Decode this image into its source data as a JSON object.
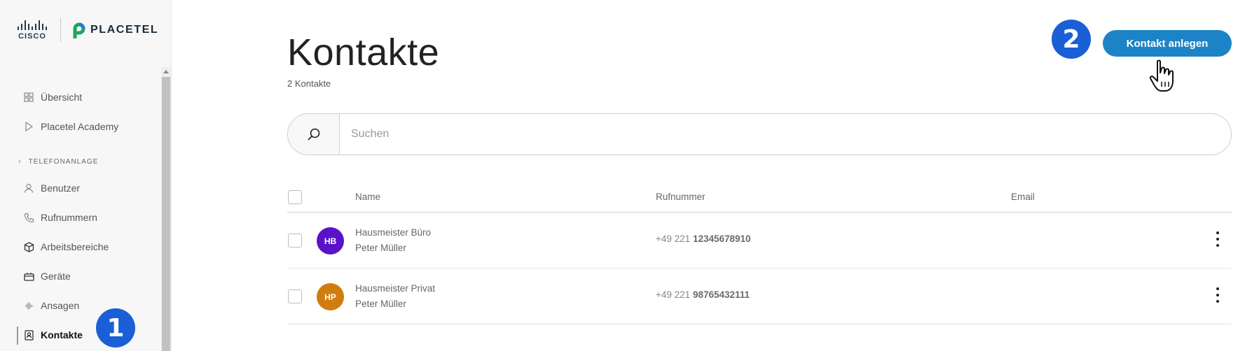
{
  "brand": {
    "cisco": "CISCO",
    "placetel": "PLACETEL"
  },
  "sidebar": {
    "items_top": [
      {
        "label": "Übersicht",
        "icon": "grid-icon"
      },
      {
        "label": "Placetel Academy",
        "icon": "play-icon"
      }
    ],
    "section_label": "TELEFONANLAGE",
    "items": [
      {
        "label": "Benutzer",
        "icon": "user-icon"
      },
      {
        "label": "Rufnummern",
        "icon": "phone-icon"
      },
      {
        "label": "Arbeitsbereiche",
        "icon": "cube-icon"
      },
      {
        "label": "Geräte",
        "icon": "device-icon"
      },
      {
        "label": "Ansagen",
        "icon": "soundwave-icon"
      },
      {
        "label": "Kontakte",
        "icon": "contact-card-icon",
        "active": true
      }
    ]
  },
  "annotations": {
    "step1": "1",
    "step2": "2",
    "badge_color": "#1a5fd6"
  },
  "page": {
    "title": "Kontakte",
    "subtitle": "2 Kontakte",
    "create_button": "Kontakt anlegen",
    "accent": "#1c84c6"
  },
  "search": {
    "placeholder": "Suchen",
    "value": ""
  },
  "table": {
    "columns": {
      "name": "Name",
      "phone": "Rufnummer",
      "email": "Email"
    },
    "rows": [
      {
        "initials": "HB",
        "avatar_color": "#5a12c9",
        "name": "Hausmeister Büro",
        "person": "Peter Müller",
        "phone_prefix": "+49 221",
        "phone_number": "12345678910",
        "email": ""
      },
      {
        "initials": "HP",
        "avatar_color": "#d17c0f",
        "name": "Hausmeister Privat",
        "person": "Peter Müller",
        "phone_prefix": "+49 221",
        "phone_number": "98765432111",
        "email": ""
      }
    ]
  }
}
